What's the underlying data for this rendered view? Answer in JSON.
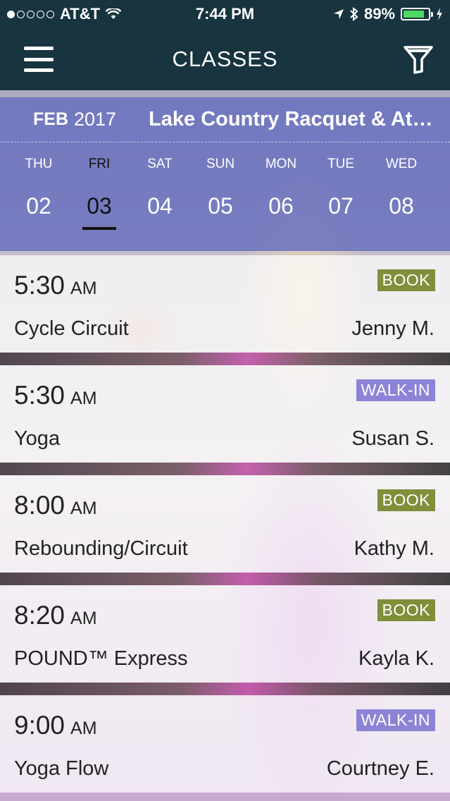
{
  "status_bar": {
    "carrier": "AT&T",
    "time": "7:44 PM",
    "battery": "89%"
  },
  "nav": {
    "title": "CLASSES"
  },
  "calendar": {
    "month": "FEB",
    "year": "2017",
    "club": "Lake Country Racquet & At…",
    "days": [
      {
        "name": "THU",
        "num": "02"
      },
      {
        "name": "FRI",
        "num": "03"
      },
      {
        "name": "SAT",
        "num": "04"
      },
      {
        "name": "SUN",
        "num": "05"
      },
      {
        "name": "MON",
        "num": "06"
      },
      {
        "name": "TUE",
        "num": "07"
      },
      {
        "name": "WED",
        "num": "08"
      }
    ]
  },
  "classes": [
    {
      "time": "5:30",
      "ampm": "AM",
      "name": "Cycle Circuit",
      "instructor": "Jenny M.",
      "badge": "BOOK"
    },
    {
      "time": "5:30",
      "ampm": "AM",
      "name": "Yoga",
      "instructor": "Susan S.",
      "badge": "WALK-IN"
    },
    {
      "time": "8:00",
      "ampm": "AM",
      "name": "Rebounding/Circuit",
      "instructor": "Kathy M.",
      "badge": "BOOK"
    },
    {
      "time": "8:20",
      "ampm": "AM",
      "name": "POUND™ Express",
      "instructor": "Kayla K.",
      "badge": "BOOK"
    },
    {
      "time": "9:00",
      "ampm": "AM",
      "name": "Yoga Flow",
      "instructor": "Courtney E.",
      "badge": "WALK-IN"
    }
  ]
}
